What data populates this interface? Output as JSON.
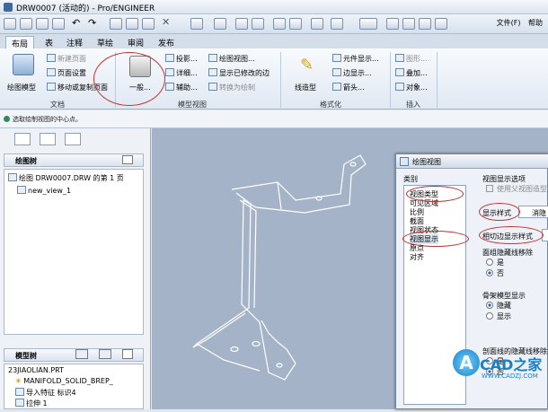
{
  "window": {
    "title": "DRW0007 (活动的) - Pro/ENGINEER",
    "menu_file": "文件(F)",
    "menu_help": "帮助"
  },
  "tabs": [
    "布局",
    "表",
    "注释",
    "草绘",
    "审阅",
    "发布"
  ],
  "ribbon": {
    "doc": {
      "drawing_model": "绘图模型",
      "new_page": "新建页面",
      "page_setup": "页面设置",
      "move_copy": "移动或复制页面",
      "group": "文档"
    },
    "model_views": {
      "general": "一般...",
      "projection": "投影...",
      "detail": "详细...",
      "auxiliary": "辅助...",
      "drawing_view": "绘图视图...",
      "show_modified_edges": "显示已修改的边",
      "convert_draft": "转换为绘制",
      "group": "模型视图"
    },
    "format": {
      "line_style": "线造型",
      "element_display": "元件显示...",
      "edge_display": "边显示...",
      "arrows": "箭头...",
      "group": "格式化"
    },
    "insert": {
      "shape": "图形...",
      "overlay": "叠加...",
      "object": "对象...",
      "group": "插入"
    }
  },
  "status": "选取绘制视图的中心点。",
  "drawing_tree": {
    "header": "绘图树",
    "root": "绘图 DRW0007.DRW 的第 1 页",
    "child": "new_view_1"
  },
  "model_tree": {
    "header": "模型树",
    "items": [
      "23JIAOLIAN.PRT",
      "MANIFOLD_SOLID_BREP_",
      "导入特征 标识4",
      "拉伸 1"
    ]
  },
  "dialog": {
    "title": "绘图视图",
    "category_label": "类别",
    "categories": [
      "视图类型",
      "可见区域",
      "比例",
      "截面",
      "视图状态",
      "视图显示",
      "原点",
      "对齐"
    ],
    "options_label": "视图显示选项",
    "use_parent": "使用父视图造型",
    "display_style_label": "显示样式",
    "display_style_value": "消隐",
    "tangent_label": "相切边显示样式",
    "hidden_removal_label": "面组隐藏线移除",
    "yes": "是",
    "no": "否",
    "skeleton_label": "骨架模型显示",
    "hide": "隐藏",
    "show": "显示",
    "section_hidden_label": "剖面线的隐藏线移除"
  },
  "watermark": {
    "brand": "CAD之家",
    "url": "WWW.CADZJ.COM"
  }
}
